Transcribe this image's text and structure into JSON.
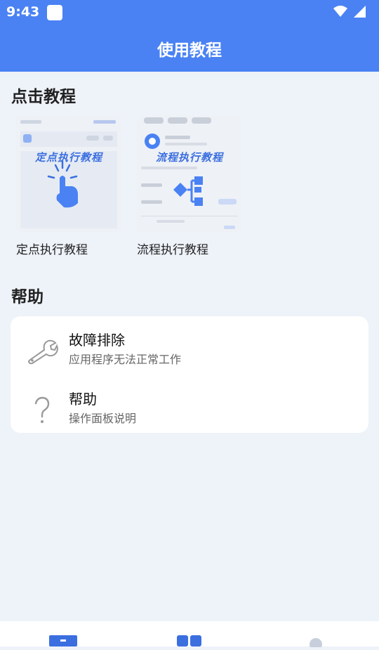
{
  "status_bar": {
    "time": "9:43"
  },
  "header": {
    "title": "使用教程"
  },
  "tutorials": {
    "section_title": "点击教程",
    "items": [
      {
        "label": "定点执行教程",
        "thumbnail_text": "定点执行教程"
      },
      {
        "label": "流程执行教程",
        "thumbnail_text": "流程执行教程"
      }
    ]
  },
  "help": {
    "section_title": "帮助",
    "items": [
      {
        "title": "故障排除",
        "subtitle": "应用程序无法正常工作",
        "icon": "wrench-icon"
      },
      {
        "title": "帮助",
        "subtitle": "操作面板说明",
        "icon": "question-icon"
      }
    ]
  },
  "bottom_nav": {
    "icons": [
      "monitor-icon",
      "grid-icon",
      "profile-icon"
    ]
  },
  "colors": {
    "accent": "#4a82f3",
    "background": "#eef2f9"
  }
}
